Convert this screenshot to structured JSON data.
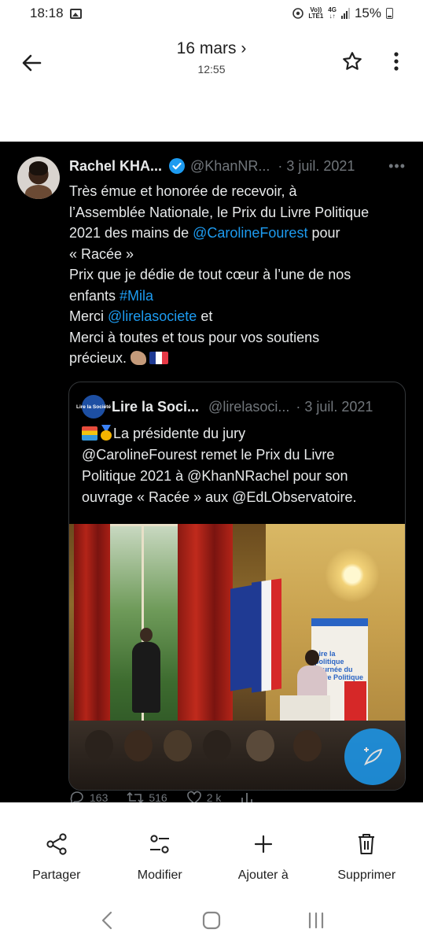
{
  "status_bar": {
    "time": "18:18",
    "net_top": "Vo))",
    "net_bottom": "LTE1",
    "net_gen": "4G",
    "battery": "15%"
  },
  "header": {
    "date": "16 mars ›",
    "time": "12:55"
  },
  "tweet": {
    "author_name": "Rachel KHA...",
    "handle": "@KhanNR...",
    "date": "· 3 juil. 2021",
    "more": "•••",
    "lines": {
      "l1": "Très émue et honorée de recevoir,  à",
      "l2": "l’Assemblée Nationale, le Prix du Livre Politique",
      "l3a": "2021 des mains de ",
      "l3_link": "@CarolineFourest",
      "l3b": " pour",
      "l4": "« Racée »",
      "l5": "Prix que je dédie de tout cœur à l’une de nos",
      "l6a": "enfants ",
      "l6_link": "#Mila",
      "l7a": "Merci ",
      "l7_link": "@lirelasociete",
      "l7b": " et",
      "l8": "Merci à toutes et tous pour vos soutiens",
      "l9": "précieux. "
    }
  },
  "quote": {
    "avatar_text": "Lire la Société",
    "name": "Lire la Soci...",
    "handle": "@lirelasoci...",
    "date": "· 3 juil. 2021",
    "line1": "La présidente du jury",
    "line2": "@CarolineFourest remet le Prix du Livre",
    "line3": "Politique 2021 à @KhanNRachel pour son",
    "line4": "ouvrage « Racée » aux @EdLObservatoire.",
    "banner_text": "Lire la politique Journée du Livre Politique"
  },
  "tweet_actions": {
    "replies": "163",
    "retweets": "516",
    "likes": "2 k"
  },
  "bottom_actions": [
    {
      "label": "Partager",
      "icon": "share-icon"
    },
    {
      "label": "Modifier",
      "icon": "edit-sliders-icon"
    },
    {
      "label": "Ajouter à",
      "icon": "plus-icon"
    },
    {
      "label": "Supprimer",
      "icon": "trash-icon"
    }
  ],
  "colors": {
    "link": "#1d9bf0",
    "tweet_bg": "#000000",
    "muted": "#71767b"
  }
}
